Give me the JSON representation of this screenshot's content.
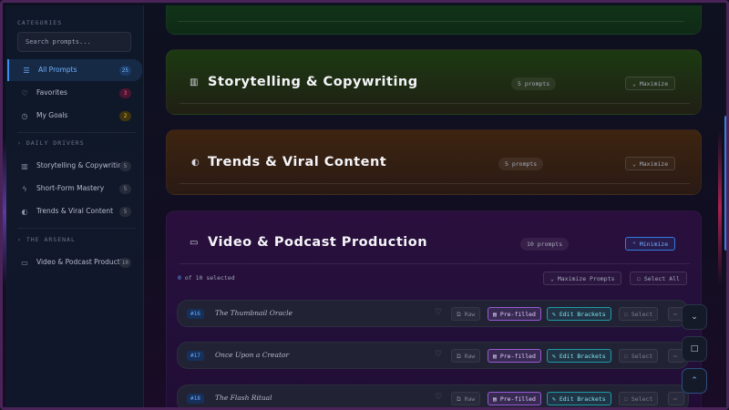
{
  "sidebar": {
    "categories_heading": "CATEGORIES",
    "search_placeholder": "Search prompts...",
    "top_items": [
      {
        "label": "All Prompts",
        "count": "25",
        "icon": "list-icon"
      },
      {
        "label": "Favorites",
        "count": "3",
        "icon": "heart-icon"
      },
      {
        "label": "My Goals",
        "count": "2",
        "icon": "target-icon"
      }
    ],
    "daily_heading": "DAILY DRIVERS",
    "daily_items": [
      {
        "label": "Storytelling & Copywriting",
        "count": "5",
        "icon": "book-icon"
      },
      {
        "label": "Short-Form Mastery",
        "count": "5",
        "icon": "bolt-icon"
      },
      {
        "label": "Trends & Viral Content",
        "count": "5",
        "icon": "trend-icon"
      }
    ],
    "arsenal_heading": "THE ARSENAL",
    "arsenal_items": [
      {
        "label": "Video & Podcast Production",
        "count": "10",
        "icon": "video-icon"
      }
    ]
  },
  "sections": {
    "storytelling": {
      "title": "Storytelling & Copywriting",
      "count": "5 prompts",
      "action": "Maximize",
      "icon": "book-icon"
    },
    "trends": {
      "title": "Trends & Viral Content",
      "count": "5 prompts",
      "action": "Maximize",
      "icon": "trend-icon"
    },
    "video": {
      "title": "Video & Podcast Production",
      "count": "10 prompts",
      "action": "Minimize",
      "icon": "video-icon"
    }
  },
  "selection": {
    "count_num": "0",
    "count_text": "of 10 selected",
    "maximize_prompts": "Maximize Prompts",
    "select_all": "Select All"
  },
  "row_actions": {
    "raw": "Raw",
    "prefilled": "Pre-filled",
    "edit_brackets": "Edit Brackets",
    "select": "Select"
  },
  "prompts": [
    {
      "num": "#16",
      "title": "The Thumbnail Oracle"
    },
    {
      "num": "#17",
      "title": "Once Upon a Creator"
    },
    {
      "num": "#18",
      "title": "The Flash Ritual"
    }
  ],
  "colors": {
    "accent_blue": "#3b8df0",
    "prefilled_purple": "#9a58d6",
    "edit_teal": "#1f9aa6",
    "favorites_pink": "#ff5a8a",
    "goals_yellow": "#f2c12e"
  }
}
